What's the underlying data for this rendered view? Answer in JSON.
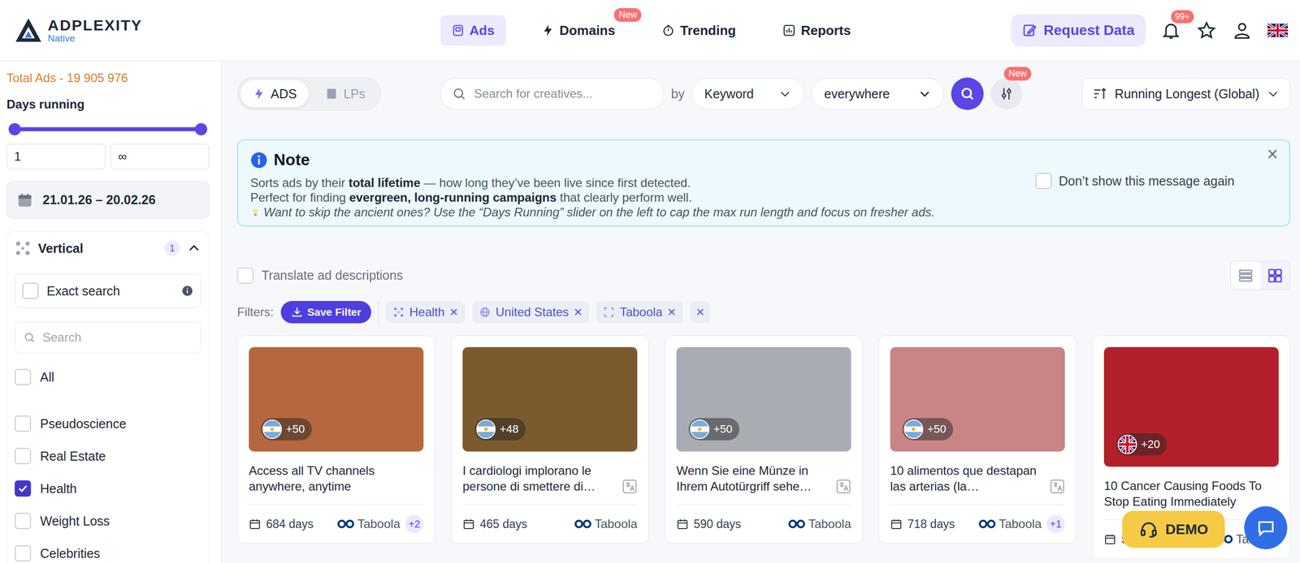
{
  "logo": {
    "name": "ADPLEXITY",
    "sub": "Native"
  },
  "nav": [
    {
      "label": "Ads",
      "selected": true
    },
    {
      "label": "Domains",
      "selected": false,
      "badge": "New"
    },
    {
      "label": "Trending",
      "selected": false
    },
    {
      "label": "Reports",
      "selected": false
    }
  ],
  "header": {
    "request": "Request Data",
    "notifications": "99+",
    "language": "gb"
  },
  "sidebar": {
    "total": "Total Ads - 19 905 976",
    "days_title": "Days running",
    "slider": {
      "low_level": 0,
      "high_level": 1
    },
    "days_min": "1",
    "days_max": "∞",
    "date_range": "21.01.26 – 20.02.26",
    "vertical": {
      "title": "Vertical",
      "count": "1",
      "expanded": true,
      "exact_search": {
        "label": "Exact search",
        "checked": false
      },
      "search_placeholder": "Search",
      "items": [
        {
          "label": "All",
          "checked": false
        },
        {
          "label": "Pseudoscience",
          "checked": false
        },
        {
          "label": "Real Estate",
          "checked": false
        },
        {
          "label": "Health",
          "checked": true
        },
        {
          "label": "Weight Loss",
          "checked": false
        },
        {
          "label": "Celebrities",
          "checked": false
        }
      ]
    }
  },
  "toolbar": {
    "modes": [
      {
        "label": "ADS",
        "selected": true
      },
      {
        "label": "LPs",
        "selected": false
      }
    ],
    "search_placeholder": "Search for creatives...",
    "by": "by",
    "field": "Keyword",
    "scope": "everywhere",
    "filter_badge": "New",
    "sort": "Running Longest (Global)"
  },
  "note": {
    "title": "Note",
    "lines": [
      [
        {
          "text": "Sorts ads by their ",
          "bold": false
        },
        {
          "text": "total lifetime",
          "bold": true
        },
        {
          "text": " — how long they’ve been live since first detected.",
          "bold": false
        }
      ],
      [
        {
          "text": "Perfect for finding ",
          "bold": false
        },
        {
          "text": "evergreen, long-running campaigns",
          "bold": true
        },
        {
          "text": " that clearly perform well.",
          "bold": false
        }
      ]
    ],
    "tip": "Want to skip the ancient ones? Use the “Days Running” slider on the left to cap the max run length and focus on fresher ads.",
    "dont_show": {
      "label": "Don’t show this message again",
      "checked": false
    },
    "close": "×"
  },
  "translate": {
    "label": "Translate ad descriptions",
    "checked": false
  },
  "view": [
    {
      "kind": "list",
      "selected": false
    },
    {
      "kind": "grid",
      "selected": true
    }
  ],
  "filters": {
    "label": "Filters:",
    "save": "Save Filter",
    "chips": [
      {
        "label": "Health",
        "kind": "vertical",
        "remove": "×"
      },
      {
        "label": "United States",
        "kind": "country",
        "remove": "×"
      },
      {
        "label": "Taboola",
        "kind": "network",
        "remove": "×"
      }
    ],
    "clear": "×"
  },
  "cards": [
    {
      "title": "Access all TV channels anywhere, anytime",
      "flag": "ar",
      "count": "+50",
      "days": "684 days",
      "network": "Taboola",
      "more": "+2",
      "translatable": false
    },
    {
      "title": "I cardiologi implorano le persone di smettere di…",
      "flag": "ar",
      "count": "+48",
      "days": "465 days",
      "network": "Taboola",
      "translatable": true
    },
    {
      "title": "Wenn Sie eine Münze in Ihrem Autotürgriff sehe…",
      "flag": "ar",
      "count": "+50",
      "days": "590 days",
      "network": "Taboola",
      "translatable": true
    },
    {
      "title": "10 alimentos que destapan las arterias (la…",
      "flag": "ar",
      "count": "+50",
      "days": "718 days",
      "network": "Taboola",
      "more": "+1",
      "translatable": true
    },
    {
      "title": "10 Cancer Causing Foods To Stop Eating Immediately",
      "flag": "gb",
      "count": "+20",
      "days": "508 days",
      "network": "Taboola",
      "translatable": false
    }
  ],
  "demo": "DEMO"
}
